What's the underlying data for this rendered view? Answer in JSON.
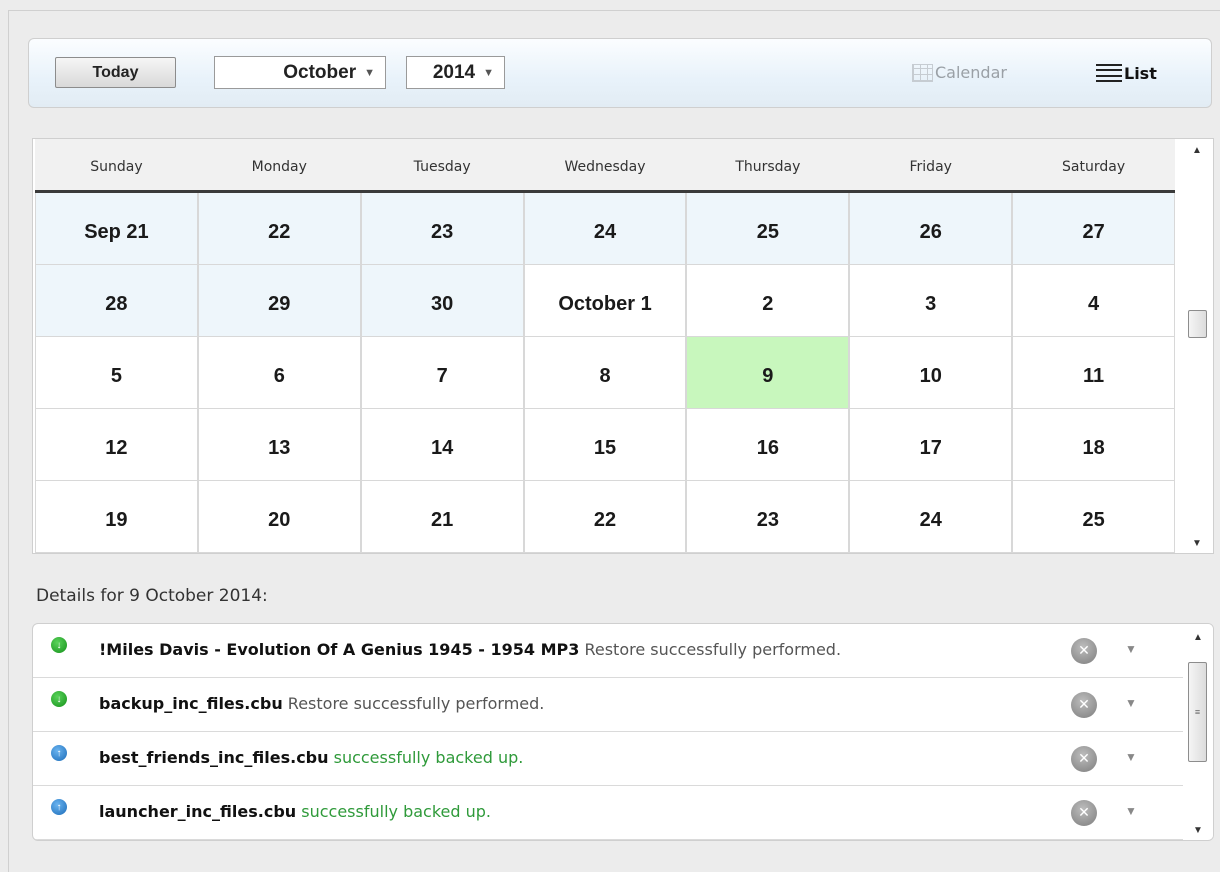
{
  "toolbar": {
    "today_label": "Today",
    "month": "October",
    "year": "2014",
    "view_calendar_label": "Calendar",
    "view_list_label": "List"
  },
  "calendar": {
    "day_names": [
      "Sunday",
      "Monday",
      "Tuesday",
      "Wednesday",
      "Thursday",
      "Friday",
      "Saturday"
    ],
    "weeks": [
      [
        "Sep 21",
        "22",
        "23",
        "24",
        "25",
        "26",
        "27"
      ],
      [
        "28",
        "29",
        "30",
        "October 1",
        "2",
        "3",
        "4"
      ],
      [
        "5",
        "6",
        "7",
        "8",
        "9",
        "10",
        "11"
      ],
      [
        "12",
        "13",
        "14",
        "15",
        "16",
        "17",
        "18"
      ],
      [
        "19",
        "20",
        "21",
        "22",
        "23",
        "24",
        "25"
      ]
    ],
    "selected_date": "9"
  },
  "details": {
    "title": "Details for 9 October 2014:",
    "items": [
      {
        "name": "!Miles Davis - Evolution Of A Genius 1945 - 1954 MP3",
        "status": "Restore successfully performed.",
        "type": "restore"
      },
      {
        "name": "backup_inc_files.cbu",
        "status": "Restore successfully performed.",
        "type": "restore"
      },
      {
        "name": "best_friends_inc_files.cbu",
        "status": "successfully backed up.",
        "type": "backup"
      },
      {
        "name": "launcher_inc_files.cbu",
        "status": "successfully backed up.",
        "type": "backup"
      }
    ]
  },
  "icons": {
    "restore": "restore-arrow-icon",
    "backup": "backup-arrow-icon",
    "close": "close-icon",
    "expand": "chevron-down-icon"
  },
  "colors": {
    "selected_day": "#c8f7bd",
    "prev_month_day": "#eef6fb",
    "backup_status": "#2f9a3a"
  }
}
